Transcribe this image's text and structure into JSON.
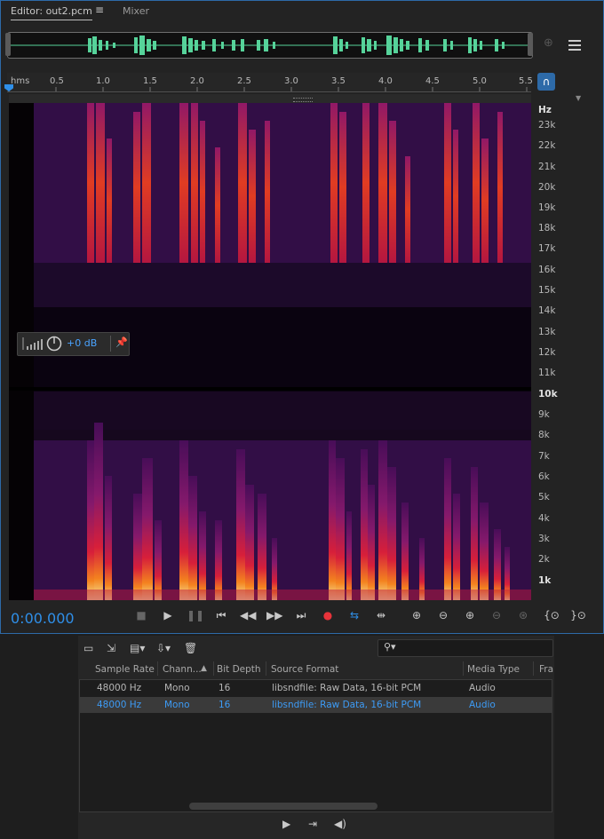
{
  "tabs": {
    "editor": "Editor: out2.pcm",
    "menu": "≡",
    "mixer": "Mixer"
  },
  "ruler": {
    "unit": "hms",
    "ticks": [
      "0.5",
      "1.0",
      "1.5",
      "2.0",
      "2.5",
      "3.0",
      "3.5",
      "4.0",
      "4.5",
      "5.0",
      "5.5"
    ]
  },
  "hz_axis": {
    "unit": "Hz",
    "labels": [
      "23k",
      "22k",
      "21k",
      "20k",
      "19k",
      "18k",
      "17k",
      "16k",
      "15k",
      "14k",
      "13k",
      "12k",
      "11k",
      "10k",
      "9k",
      "8k",
      "7k",
      "6k",
      "5k",
      "4k",
      "3k",
      "2k",
      "1k"
    ]
  },
  "hud": {
    "value": "+0 dB"
  },
  "transport": {
    "time": "0:00.000"
  },
  "files": {
    "columns": [
      "Sample Rate",
      "Chann...",
      "Bit Depth",
      "Source Format",
      "Media Type",
      "Fra"
    ],
    "rows": [
      [
        "48000 Hz",
        "Mono",
        "16",
        "libsndfile: Raw Data, 16-bit PCM",
        "Audio"
      ],
      [
        "48000 Hz",
        "Mono",
        "16",
        "libsndfile: Raw Data, 16-bit PCM",
        "Audio"
      ]
    ]
  },
  "colors": {
    "accent": "#2f8fe8",
    "waveform": "#56d39a",
    "record": "#e8333a"
  },
  "icons": [
    "list-icon",
    "zoom-icon",
    "snap-magnet-icon",
    "stop-icon",
    "play-icon",
    "pause-icon",
    "skip-back-icon",
    "rewind-icon",
    "fast-forward-icon",
    "skip-forward-icon",
    "record-icon",
    "loop-icon",
    "skip-selection-icon",
    "zoom-in-amplitude-icon",
    "zoom-out-amplitude-icon",
    "zoom-in-time-icon",
    "zoom-out-time-icon",
    "zoom-full-icon",
    "zoom-in-selection-icon",
    "zoom-out-selection-icon",
    "folder-icon",
    "import-icon",
    "insert-icon",
    "export-icon",
    "trash-icon",
    "search-icon"
  ]
}
